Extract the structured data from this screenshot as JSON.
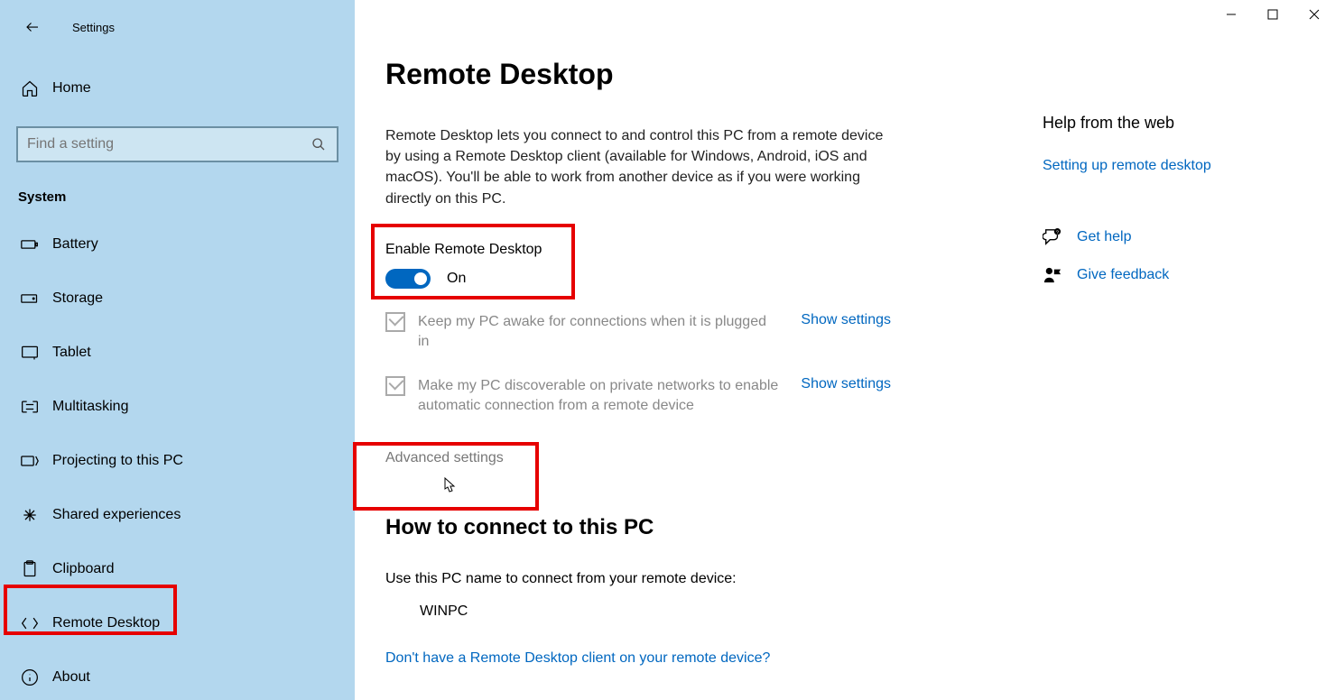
{
  "app_title": "Settings",
  "home_label": "Home",
  "search_placeholder": "Find a setting",
  "category": "System",
  "nav": [
    {
      "label": "Battery"
    },
    {
      "label": "Storage"
    },
    {
      "label": "Tablet"
    },
    {
      "label": "Multitasking"
    },
    {
      "label": "Projecting to this PC"
    },
    {
      "label": "Shared experiences"
    },
    {
      "label": "Clipboard"
    },
    {
      "label": "Remote Desktop"
    },
    {
      "label": "About"
    }
  ],
  "page": {
    "title": "Remote Desktop",
    "description": "Remote Desktop lets you connect to and control this PC from a remote device by using a Remote Desktop client (available for Windows, Android, iOS and macOS). You'll be able to work from another device as if you were working directly on this PC.",
    "enable_label": "Enable Remote Desktop",
    "toggle_state": "On",
    "option1": "Keep my PC awake for connections when it is plugged in",
    "option2": "Make my PC discoverable on private networks to enable automatic connection from a remote device",
    "show_settings": "Show settings",
    "advanced": "Advanced settings",
    "connect_title": "How to connect to this PC",
    "connect_desc": "Use this PC name to connect from your remote device:",
    "pc_name": "WINPC",
    "no_client": "Don't have a Remote Desktop client on your remote device?"
  },
  "right": {
    "help_title": "Help from the web",
    "setup_link": "Setting up remote desktop",
    "get_help": "Get help",
    "feedback": "Give feedback"
  }
}
